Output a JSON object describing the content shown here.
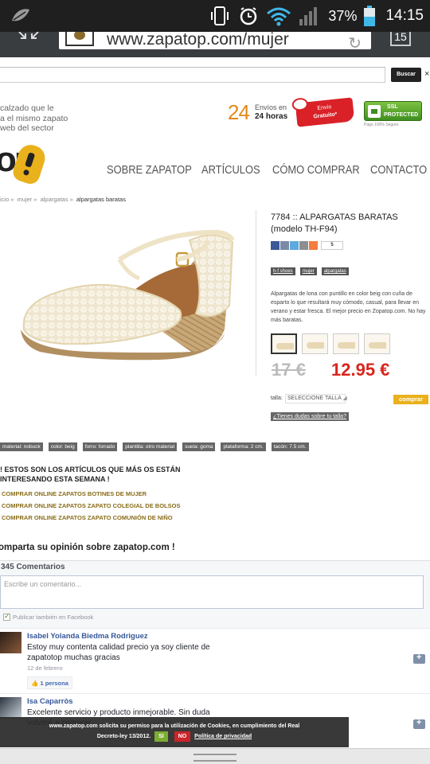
{
  "status_bar": {
    "battery_percent": "37%",
    "time": "14:15"
  },
  "browser": {
    "url": "www.zapatop.com/mujer",
    "tab_count": "15"
  },
  "search": {
    "button_label": "Buscar",
    "close": "×"
  },
  "header": {
    "slogan_lines": [
      "calzado que le",
      "a el mismo zapato",
      "web del sector"
    ],
    "envios_number": "24",
    "envios_line1": "Envíos en",
    "envios_line2": "24 horas",
    "gratis_line1": "Envío",
    "gratis_line2": "Gratuito*",
    "ssl_line1": "SSL",
    "ssl_line2": "PROTECTED",
    "ssl_caption": "Pago 100% Seguro",
    "logo_text": "op"
  },
  "nav": [
    "SOBRE ZAPATOP",
    "ARTÍCULOS",
    "CÓMO COMPRAR",
    "CONTACTO"
  ],
  "breadcrumb": [
    "icio",
    "mujer",
    "alpargatas",
    "alpargatas baratas"
  ],
  "product": {
    "title": "7784 :: ALPARGATAS BARATAS (modelo TH-F94)",
    "share_count": "5",
    "tags": [
      "h-f shoes",
      "mujer",
      "alpargatas"
    ],
    "description": "Alpargatas de lona con puntillo en color beig con cuña de esparto lo que resultará muy cómodo, casual, para llevar en verano y estar fresca. El mejor precio en Zopatop.com. No hay más baratas.",
    "price_old": "17 €",
    "price_new": "12.95 €",
    "talla_label": "talla:",
    "talla_placeholder": "SELECCIONE TALLA",
    "buy_label": "comprar",
    "size_help": "¿Tienes dudas sobre tu talla?",
    "attributes": [
      "material: nobuck",
      "color: beig",
      "forro: forrado",
      "plantilla: otro material",
      "suela: goma",
      "plataforma: 2 cm.",
      "tacón: 7.5 cm."
    ]
  },
  "interest": {
    "heading_line1": "! ESTOS SON LOS ARTÍCULOS QUE MÁS OS ESTÁN",
    "heading_line2": "INTERESANDO ESTA SEMANA !",
    "links": [
      "COMPRAR ONLINE ZAPATOS BOTINES DE MUJER",
      "COMPRAR ONLINE ZAPATOS ZAPATO COLEGIAL DE BOLSOS",
      "COMPRAR ONLINE ZAPATOS ZAPATO COMUNIÓN DE NIÑO"
    ]
  },
  "opinion_heading": "omparta su opinión sobre zapatop.com !",
  "comments": {
    "count_label": "345 Comentarios",
    "placeholder": "Escribe un comentario...",
    "also_facebook": "Publicar también en Facebook",
    "items": [
      {
        "name": "Isabel Yolanda Biedma Rodriguez",
        "text": "Estoy muy contenta calidad precio ya soy cliente de zapatotop muchas gracias",
        "date": "12 de febrero",
        "likes": "1 persona"
      },
      {
        "name": "Isa Caparròs",
        "text": "Excelente servicio y producto inmejorable. Sin duda volveré a comprar."
      }
    ]
  },
  "cookie": {
    "line1": "www.zapatop.com solicita su permiso para la utilización de Cookies, en cumplimiento del Real",
    "line2_prefix": "Decreto-ley 13/2012.",
    "yes": "SI",
    "no": "NO",
    "policy": "Política de privacidad"
  }
}
